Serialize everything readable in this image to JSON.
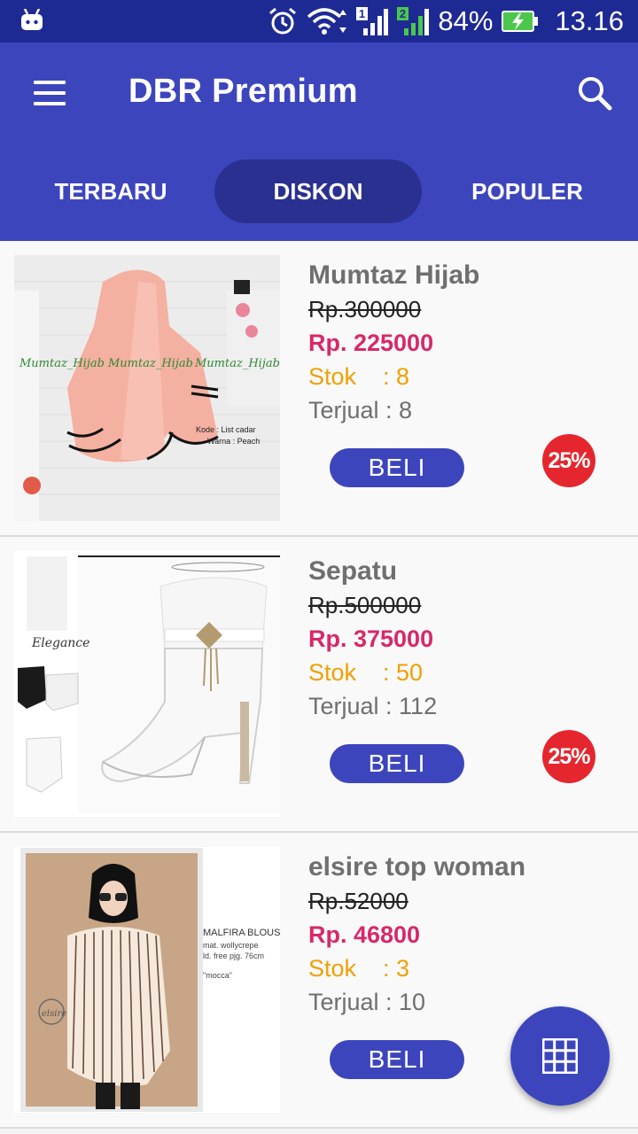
{
  "status_bar": {
    "battery": "84%",
    "time": "13.16",
    "sim1": "1",
    "sim2": "2"
  },
  "app_bar": {
    "title": "DBR Premium"
  },
  "tabs": [
    {
      "label": "TERBARU"
    },
    {
      "label": "DISKON"
    },
    {
      "label": "POPULER"
    }
  ],
  "products": [
    {
      "name": "Mumtaz Hijab",
      "old_price": "Rp.300000",
      "new_price": "Rp. 225000",
      "stock": "Stok    : 8",
      "sold": "Terjual : 8",
      "buy_label": "BELI",
      "discount": "25%",
      "image_text": [
        "Mumtaz_Hijab",
        "Mumtaz_Hijab",
        "Mumtaz_Hijab",
        "Kode : List cadar",
        "Warna : Peach"
      ]
    },
    {
      "name": "Sepatu",
      "old_price": "Rp.500000",
      "new_price": "Rp. 375000",
      "stock": "Stok    : 50",
      "sold": "Terjual : 112",
      "buy_label": "BELI",
      "discount": "25%",
      "image_text": [
        "Elegance"
      ]
    },
    {
      "name": "elsire top woman",
      "old_price": "Rp.52000",
      "new_price": "Rp. 46800",
      "stock": "Stok    : 3",
      "sold": "Terjual : 10",
      "buy_label": "BELI",
      "image_text": [
        "MALFIRA BLOUSE",
        "mat. wollycrepe",
        "ld. free pjg. 76cm",
        "\"mocca\"",
        "elsire"
      ]
    }
  ],
  "colors": {
    "primary": "#3d45bd",
    "status": "#1e2a94",
    "price": "#d8286a",
    "stock": "#f0a000",
    "badge": "#e5262e"
  },
  "icons": {
    "menu": "hamburger-icon",
    "search": "search-icon",
    "fab": "grid-icon"
  }
}
